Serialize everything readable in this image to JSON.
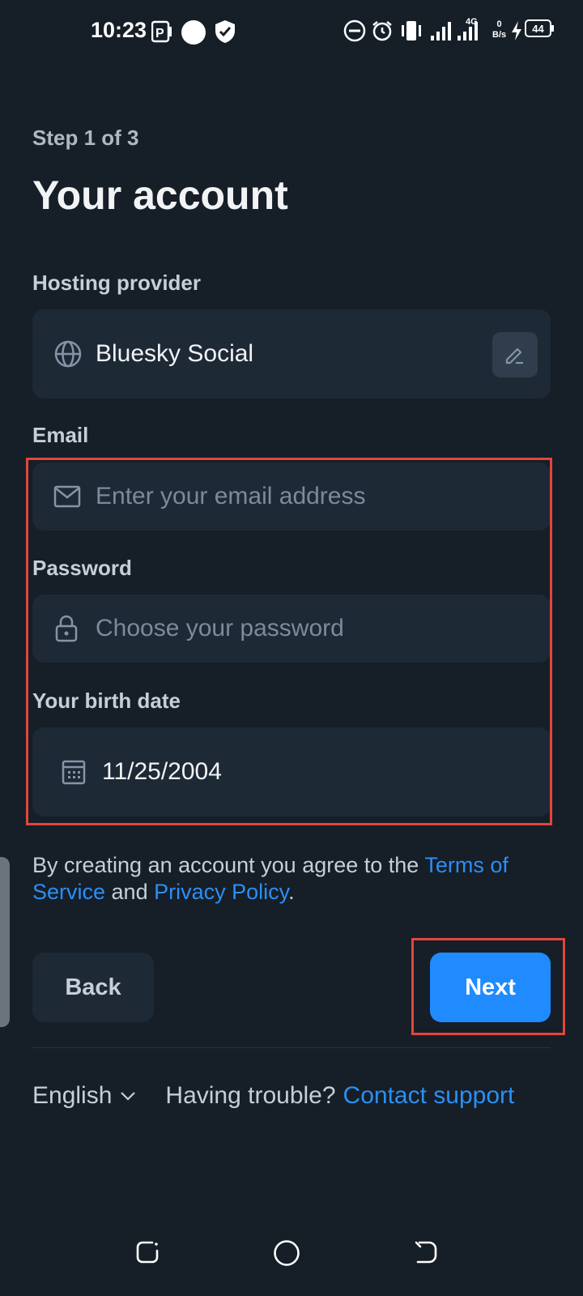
{
  "status_bar": {
    "time": "10:23",
    "network_type": "4G",
    "speed_value": "0",
    "speed_unit": "B/s",
    "battery": "44"
  },
  "header": {
    "step": "Step 1 of 3",
    "title": "Your account"
  },
  "hosting": {
    "label": "Hosting provider",
    "value": "Bluesky Social"
  },
  "email": {
    "label": "Email",
    "placeholder": "Enter your email address"
  },
  "password": {
    "label": "Password",
    "placeholder": "Choose your password"
  },
  "birth_date": {
    "label": "Your birth date",
    "value": "11/25/2004"
  },
  "legal": {
    "prefix": "By creating an account you agree to the ",
    "terms": "Terms of Service",
    "middle": " and ",
    "privacy": "Privacy Policy",
    "suffix": "."
  },
  "actions": {
    "back": "Back",
    "next": "Next"
  },
  "footer": {
    "language": "English",
    "trouble": "Having trouble?",
    "support": "Contact support"
  },
  "colors": {
    "background": "#161e27",
    "field": "#1e2936",
    "accent": "#1f8bff",
    "link": "#2b8ff5",
    "highlight": "#e2463b"
  }
}
